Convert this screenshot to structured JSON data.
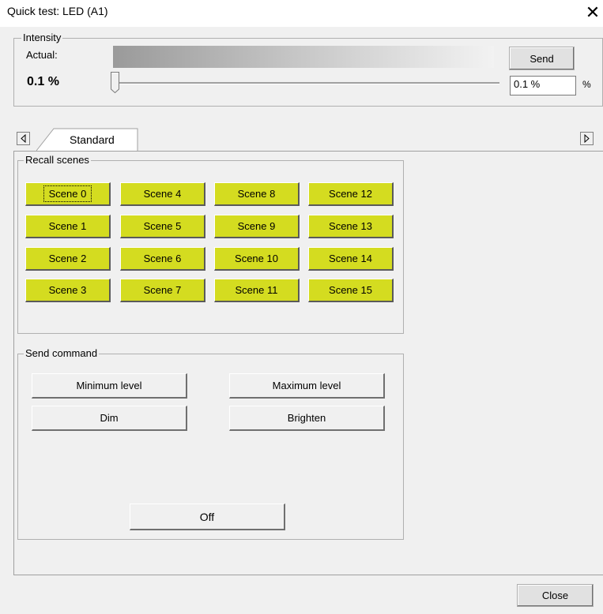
{
  "window": {
    "title": "Quick test: LED (A1)",
    "close_glyph": "✕"
  },
  "intensity": {
    "legend": "Intensity",
    "actual_label": "Actual:",
    "actual_value": "0.1 %",
    "send_label": "Send",
    "input_value": "0.1 %",
    "unit": "%",
    "slider_value_percent": 0.1
  },
  "tabs": {
    "left_arrow_icon": "arrow-left-icon",
    "right_arrow_icon": "arrow-right-icon",
    "items": [
      {
        "label": "Standard"
      }
    ]
  },
  "recall_scenes": {
    "legend": "Recall scenes",
    "scenes": [
      "Scene 0",
      "Scene 4",
      "Scene 8",
      "Scene 12",
      "Scene 1",
      "Scene 5",
      "Scene 9",
      "Scene 13",
      "Scene 2",
      "Scene 6",
      "Scene 10",
      "Scene 14",
      "Scene 3",
      "Scene 7",
      "Scene 11",
      "Scene 15"
    ],
    "scene_color": "#d4dc20"
  },
  "send_command": {
    "legend": "Send command",
    "minimum_level": "Minimum level",
    "maximum_level": "Maximum level",
    "dim": "Dim",
    "brighten": "Brighten",
    "off": "Off"
  },
  "footer": {
    "close_label": "Close"
  }
}
